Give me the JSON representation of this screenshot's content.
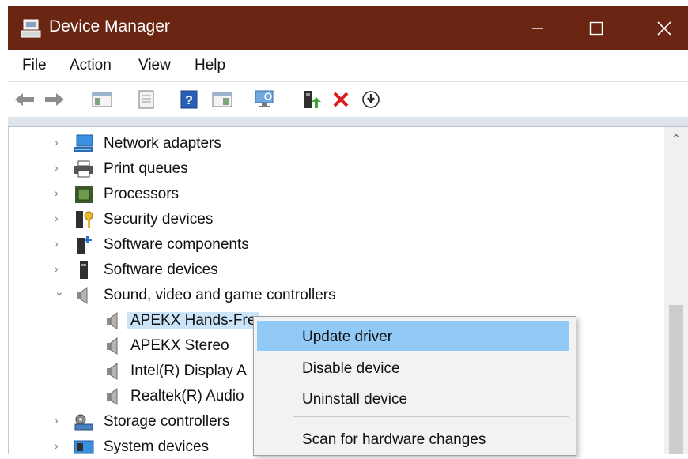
{
  "window": {
    "title": "Device Manager"
  },
  "menu": [
    "File",
    "Action",
    "View",
    "Help"
  ],
  "toolbar": {
    "icons": [
      "back-arrow-icon",
      "forward-arrow-icon",
      "show-hide-tree-icon",
      "properties-icon",
      "help-icon",
      "view-icon",
      "scan-hardware-icon",
      "update-driver-icon",
      "uninstall-icon",
      "disable-device-icon"
    ]
  },
  "tree": {
    "categories": [
      {
        "label": "Network adapters",
        "icon": "network-adapter-icon",
        "expanded": false
      },
      {
        "label": "Print queues",
        "icon": "printer-icon",
        "expanded": false
      },
      {
        "label": "Processors",
        "icon": "processor-icon",
        "expanded": false
      },
      {
        "label": "Security devices",
        "icon": "security-key-icon",
        "expanded": false
      },
      {
        "label": "Software components",
        "icon": "software-component-icon",
        "expanded": false
      },
      {
        "label": "Software devices",
        "icon": "software-device-icon",
        "expanded": false
      },
      {
        "label": "Sound, video and game controllers",
        "icon": "speaker-icon",
        "expanded": true
      },
      {
        "label": "Storage controllers",
        "icon": "storage-controller-icon",
        "expanded": false
      },
      {
        "label": "System devices",
        "icon": "system-devices-icon",
        "expanded": false
      }
    ],
    "children": [
      {
        "label": "APEKX Hands-Fre",
        "selected": true
      },
      {
        "label": "APEKX Stereo",
        "selected": false
      },
      {
        "label": "Intel(R) Display A",
        "selected": false
      },
      {
        "label": "Realtek(R) Audio",
        "selected": false
      }
    ]
  },
  "context_menu": {
    "items": [
      "Update driver",
      "Disable device",
      "Uninstall device",
      "Scan for hardware changes"
    ],
    "highlighted": "Update driver"
  },
  "colors": {
    "titlebar": "#6b2513",
    "highlight": "#91c9f7",
    "selection": "#cce4f7"
  }
}
